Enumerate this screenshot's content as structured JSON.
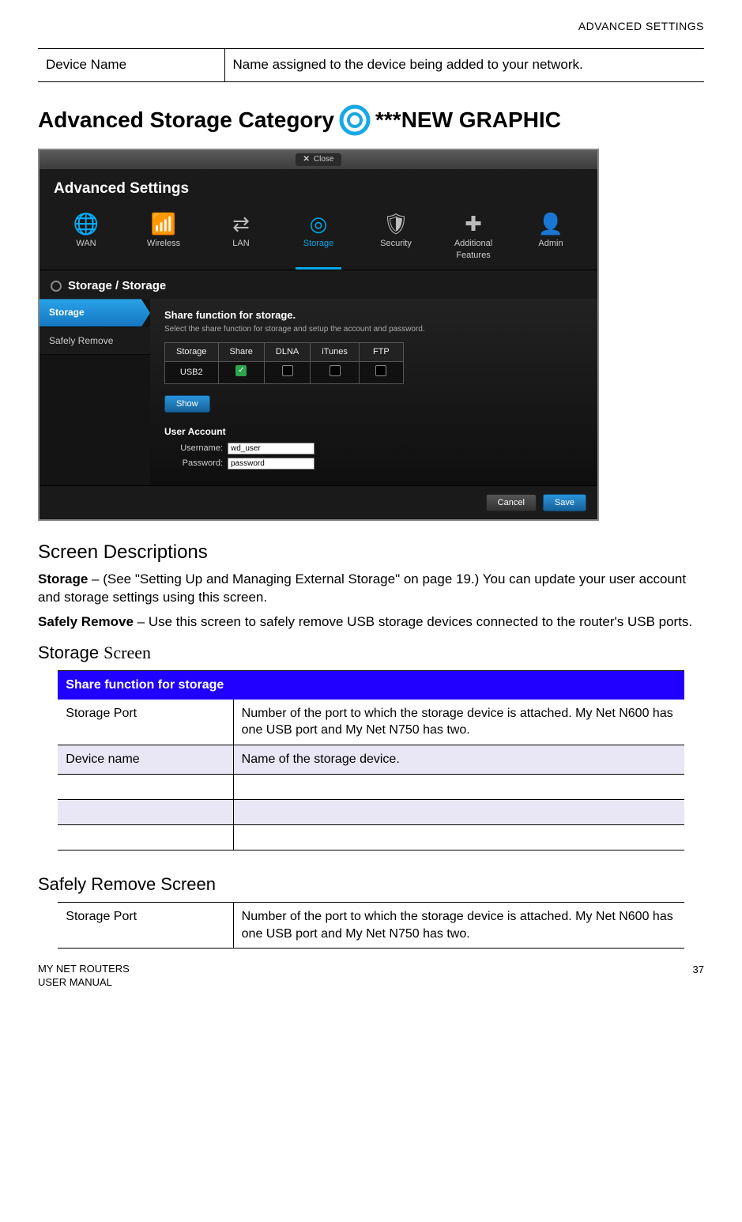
{
  "header_right": "ADVANCED SETTINGS",
  "top_table": {
    "left": "Device Name",
    "right": "Name assigned to the device being added to your network."
  },
  "h1_left": "Advanced Storage Category",
  "h1_right": "***NEW GRAPHIC",
  "ui": {
    "close": "Close",
    "title": "Advanced Settings",
    "nav": {
      "wan": "WAN",
      "wireless": "Wireless",
      "lan": "LAN",
      "storage": "Storage",
      "security": "Security",
      "features": "Additional Features",
      "admin": "Admin"
    },
    "breadcrumb": "Storage / Storage",
    "side": {
      "storage": "Storage",
      "safely": "Safely Remove"
    },
    "main_heading": "Share function for storage.",
    "main_sub": "Select the share function for storage and setup the account and password.",
    "cols": {
      "storage": "Storage",
      "share": "Share",
      "dlna": "DLNA",
      "itunes": "iTunes",
      "ftp": "FTP"
    },
    "row_storage": "USB2",
    "show": "Show",
    "ua_title": "User Account",
    "username_label": "Username:",
    "username_val": "wd_user",
    "password_label": "Password:",
    "password_val": "password",
    "cancel": "Cancel",
    "save": "Save"
  },
  "screen_desc_h": "Screen Descriptions",
  "storage_b": "Storage",
  "storage_p": " – (See \"Setting Up and Managing External Storage\" on page 19.) You can update your user account and storage settings using this screen.",
  "safely_b": "Safely Remove",
  "safely_p": " – Use this screen to safely remove USB storage devices connected to the router's USB ports.",
  "storage_screen_h_a": "Storage ",
  "storage_screen_h_b": "Screen",
  "blue_header": "Share function for storage",
  "blue_rows": {
    "r1l": "Storage Port",
    "r1r": "Number of the port to which the storage device is attached. My Net N600 has one USB port and My Net N750 has two.",
    "r2l": "Device name",
    "r2r": "Name of the storage device."
  },
  "safely_screen_h": "Safely Remove Screen",
  "plain_rows": {
    "r1l": "Storage Port",
    "r1r": "Number of the port to which the storage device is attached. My Net N600 has one USB port and My Net N750 has two."
  },
  "footer": {
    "line1": "MY NET ROUTERS",
    "line2": "USER MANUAL",
    "page": "37"
  }
}
